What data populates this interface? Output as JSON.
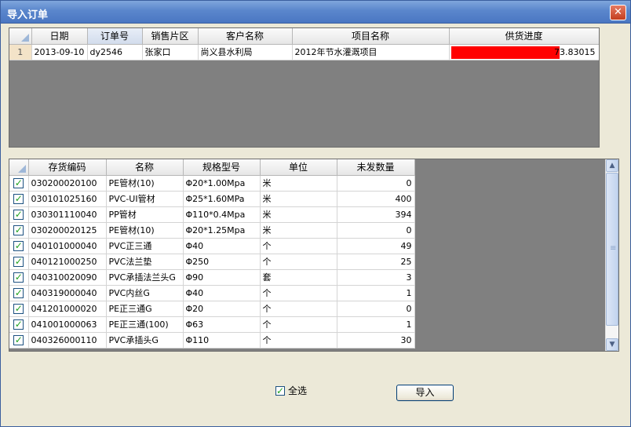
{
  "window": {
    "title": "导入订单"
  },
  "icons": {
    "close": "close-icon",
    "checkbox": "checkmark-icon",
    "scroll_up": "chevron-up-icon",
    "scroll_down": "chevron-down-icon"
  },
  "colors": {
    "progress_bar": "#ff0000",
    "titlebar": "#5a86cc"
  },
  "orders": {
    "columns": [
      "日期",
      "订单号",
      "销售片区",
      "客户名称",
      "项目名称",
      "供货进度"
    ],
    "sorted_column": "订单号",
    "rows": [
      {
        "row_no": "1",
        "date": "2013-09-10",
        "order_no": "dy2546",
        "region": "张家口",
        "customer": "尚义县水利局",
        "project": "2012年节水灌溉项目",
        "progress": 73.83015,
        "progress_text": "73.83015"
      }
    ]
  },
  "items": {
    "columns": [
      "存货编码",
      "名称",
      "规格型号",
      "单位",
      "未发数量"
    ],
    "rows": [
      {
        "checked": true,
        "code": "030200020100",
        "name": "PE管材(10)",
        "spec": "Φ20*1.00Mpa",
        "unit": "米",
        "qty": "0"
      },
      {
        "checked": true,
        "code": "030101025160",
        "name": "PVC-UI管材",
        "spec": "Φ25*1.60MPa",
        "unit": "米",
        "qty": "400"
      },
      {
        "checked": true,
        "code": "030301110040",
        "name": "PP管材",
        "spec": "Φ110*0.4Mpa",
        "unit": "米",
        "qty": "394"
      },
      {
        "checked": true,
        "code": "030200020125",
        "name": "PE管材(10)",
        "spec": "Φ20*1.25Mpa",
        "unit": "米",
        "qty": "0"
      },
      {
        "checked": true,
        "code": "040101000040",
        "name": "PVC正三通",
        "spec": "Φ40",
        "unit": "个",
        "qty": "49"
      },
      {
        "checked": true,
        "code": "040121000250",
        "name": "PVC法兰垫",
        "spec": "Φ250",
        "unit": "个",
        "qty": "25"
      },
      {
        "checked": true,
        "code": "040310020090",
        "name": "PVC承插法兰头G",
        "spec": "Φ90",
        "unit": "套",
        "qty": "3"
      },
      {
        "checked": true,
        "code": "040319000040",
        "name": "PVC内丝G",
        "spec": "Φ40",
        "unit": "个",
        "qty": "1"
      },
      {
        "checked": true,
        "code": "041201000020",
        "name": "PE正三通G",
        "spec": "Φ20",
        "unit": "个",
        "qty": "0"
      },
      {
        "checked": true,
        "code": "041001000063",
        "name": "PE正三通(100)",
        "spec": "Φ63",
        "unit": "个",
        "qty": "1"
      },
      {
        "checked": true,
        "code": "040326000110",
        "name": "PVC承插头G",
        "spec": "Φ110",
        "unit": "个",
        "qty": "30"
      }
    ]
  },
  "footer": {
    "select_all_label": "全选",
    "select_all_checked": true,
    "import_label": "导入"
  }
}
